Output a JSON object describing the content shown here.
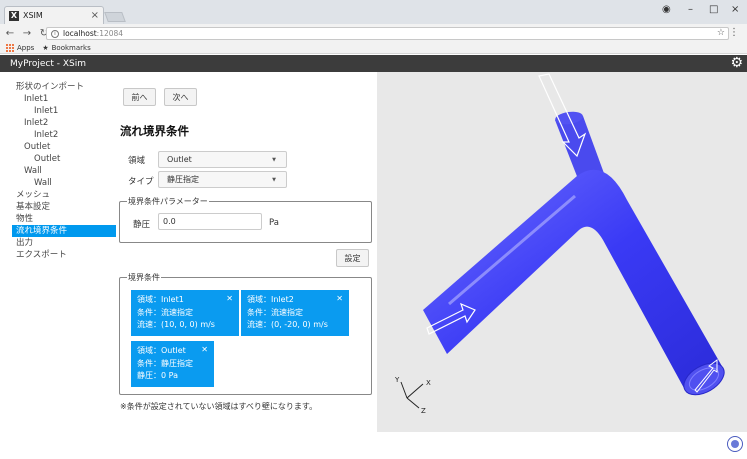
{
  "browser": {
    "tab_title": "XSIM",
    "tab_close": "×",
    "url_host": "localhost",
    "url_port": ":12084",
    "bookmarks": [
      "Apps",
      "Bookmarks"
    ],
    "window_controls": [
      "–",
      "□",
      "×"
    ]
  },
  "app": {
    "title": "MyProject - XSim"
  },
  "sidebar": {
    "items": [
      {
        "label": "形状のインポート",
        "level": 0
      },
      {
        "label": "Inlet1",
        "level": 1
      },
      {
        "label": "Inlet1",
        "level": 2
      },
      {
        "label": "Inlet2",
        "level": 1
      },
      {
        "label": "Inlet2",
        "level": 2
      },
      {
        "label": "Outlet",
        "level": 1
      },
      {
        "label": "Outlet",
        "level": 2
      },
      {
        "label": "Wall",
        "level": 1
      },
      {
        "label": "Wall",
        "level": 2
      },
      {
        "label": "メッシュ",
        "level": 0
      },
      {
        "label": "基本設定",
        "level": 0
      },
      {
        "label": "物性",
        "level": 0
      },
      {
        "label": "流れ境界条件",
        "level": 0,
        "selected": true
      },
      {
        "label": "出力",
        "level": 0
      },
      {
        "label": "エクスポート",
        "level": 0
      }
    ]
  },
  "form": {
    "prev_label": "前へ",
    "next_label": "次へ",
    "heading": "流れ境界条件",
    "region_label": "領域",
    "region_value": "Outlet",
    "type_label": "タイプ",
    "type_value": "静圧指定",
    "params_legend": "境界条件パラメーター",
    "pressure_label": "静圧",
    "pressure_value": "0.0",
    "pressure_unit": "Pa",
    "set_label": "設定",
    "conditions_legend": "境界条件",
    "footnote": "※条件が設定されていない領域はすべり壁になります。"
  },
  "conditions": [
    {
      "line1": "領域：Inlet1",
      "line2": "条件：流速指定",
      "line3": "流速：(10, 0, 0) m/s"
    },
    {
      "line1": "領域：Inlet2",
      "line2": "条件：流速指定",
      "line3": "流速：(0, -20, 0) m/s"
    },
    {
      "line1": "領域：Outlet",
      "line2": "条件：静圧指定",
      "line3": "静圧：0 Pa"
    }
  ],
  "axes": {
    "x": "X",
    "y": "Y",
    "z": "Z"
  },
  "colors": {
    "accent": "#0099ee",
    "card": "#0a9bf0",
    "pipe": "#4444ff",
    "header": "#3c3c3c",
    "viewport": "#e8e8e8"
  }
}
